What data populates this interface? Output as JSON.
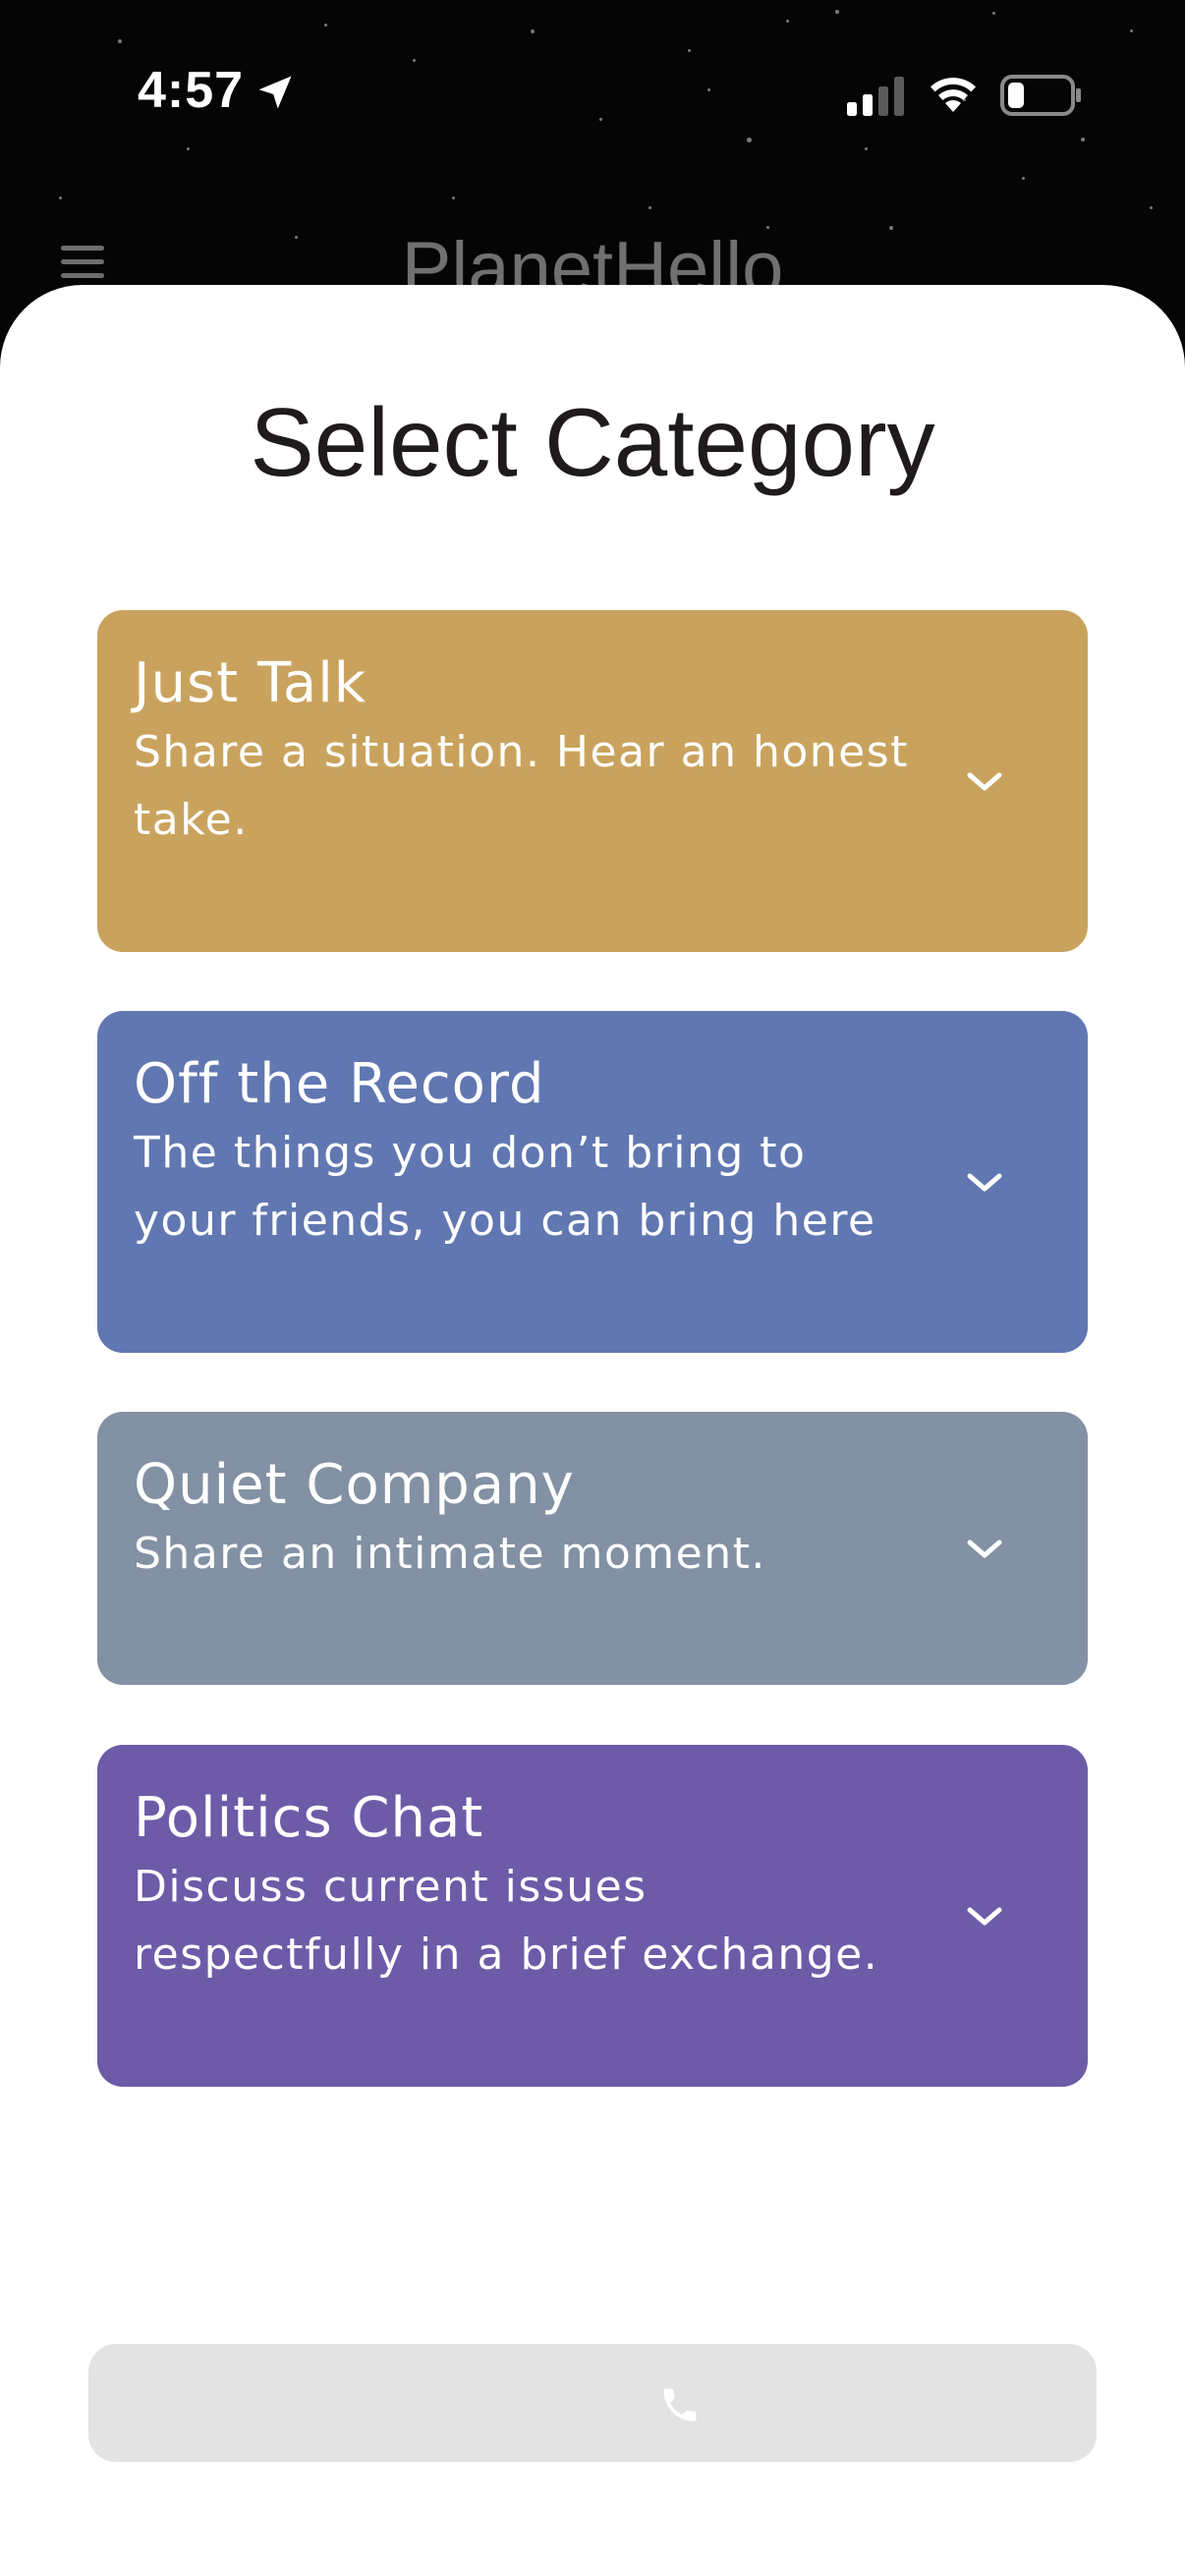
{
  "status_bar": {
    "time": "4:57",
    "location_icon": "location-arrow-icon",
    "signal_icon": "cellular-signal-icon",
    "wifi_icon": "wifi-icon",
    "battery_icon": "battery-low-icon"
  },
  "header": {
    "menu_icon": "hamburger-menu-icon",
    "app_title": "PlanetHello"
  },
  "sheet": {
    "title": "Select Category",
    "categories": [
      {
        "title": "Just Talk",
        "description": "Share a situation. Hear an honest take.",
        "color": "#C9A35E",
        "icon": "chevron-down-icon"
      },
      {
        "title": "Off the Record",
        "description": "The things you don’t bring to your friends, you can bring here",
        "color": "#6177B1",
        "icon": "chevron-down-icon"
      },
      {
        "title": "Quiet Company",
        "description": "Share an intimate moment.",
        "color": "#8291A3",
        "icon": "chevron-down-icon"
      },
      {
        "title": "Politics Chat",
        "description": "Discuss current issues respectfully in a brief exchange.",
        "color": "#6D5BA8",
        "icon": "chevron-down-icon"
      }
    ],
    "call_button": {
      "icon": "phone-icon",
      "state": "disabled"
    }
  },
  "colors": {
    "background": "#050505",
    "sheet": "#FFFFFF",
    "call_button_bg": "#E3E3E3",
    "call_icon": "#FFFFFF"
  }
}
